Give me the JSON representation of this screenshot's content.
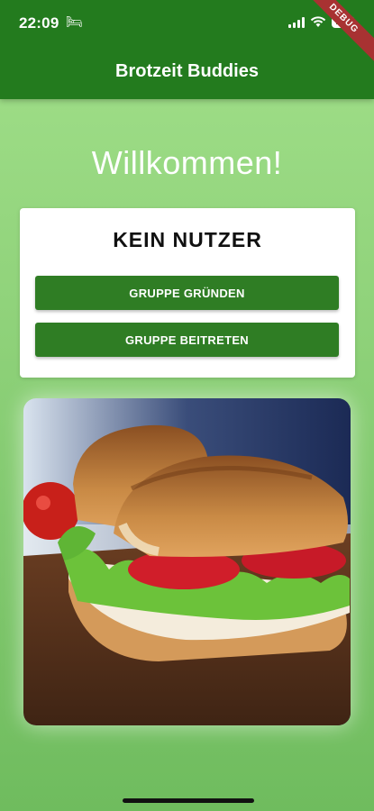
{
  "status": {
    "time": "22:09",
    "battery": "100"
  },
  "appbar": {
    "title": "Brotzeit Buddies",
    "debug_label": "DEBUG"
  },
  "main": {
    "welcome": "Willkommen!",
    "card": {
      "title": "KEIN NUTZER",
      "create_group": "GRUPPE GRÜNDEN",
      "join_group": "GRUPPE BEITRETEN"
    }
  },
  "colors": {
    "appbar": "#237b1e",
    "button": "#2f7d24",
    "background": "#8fd27a"
  }
}
